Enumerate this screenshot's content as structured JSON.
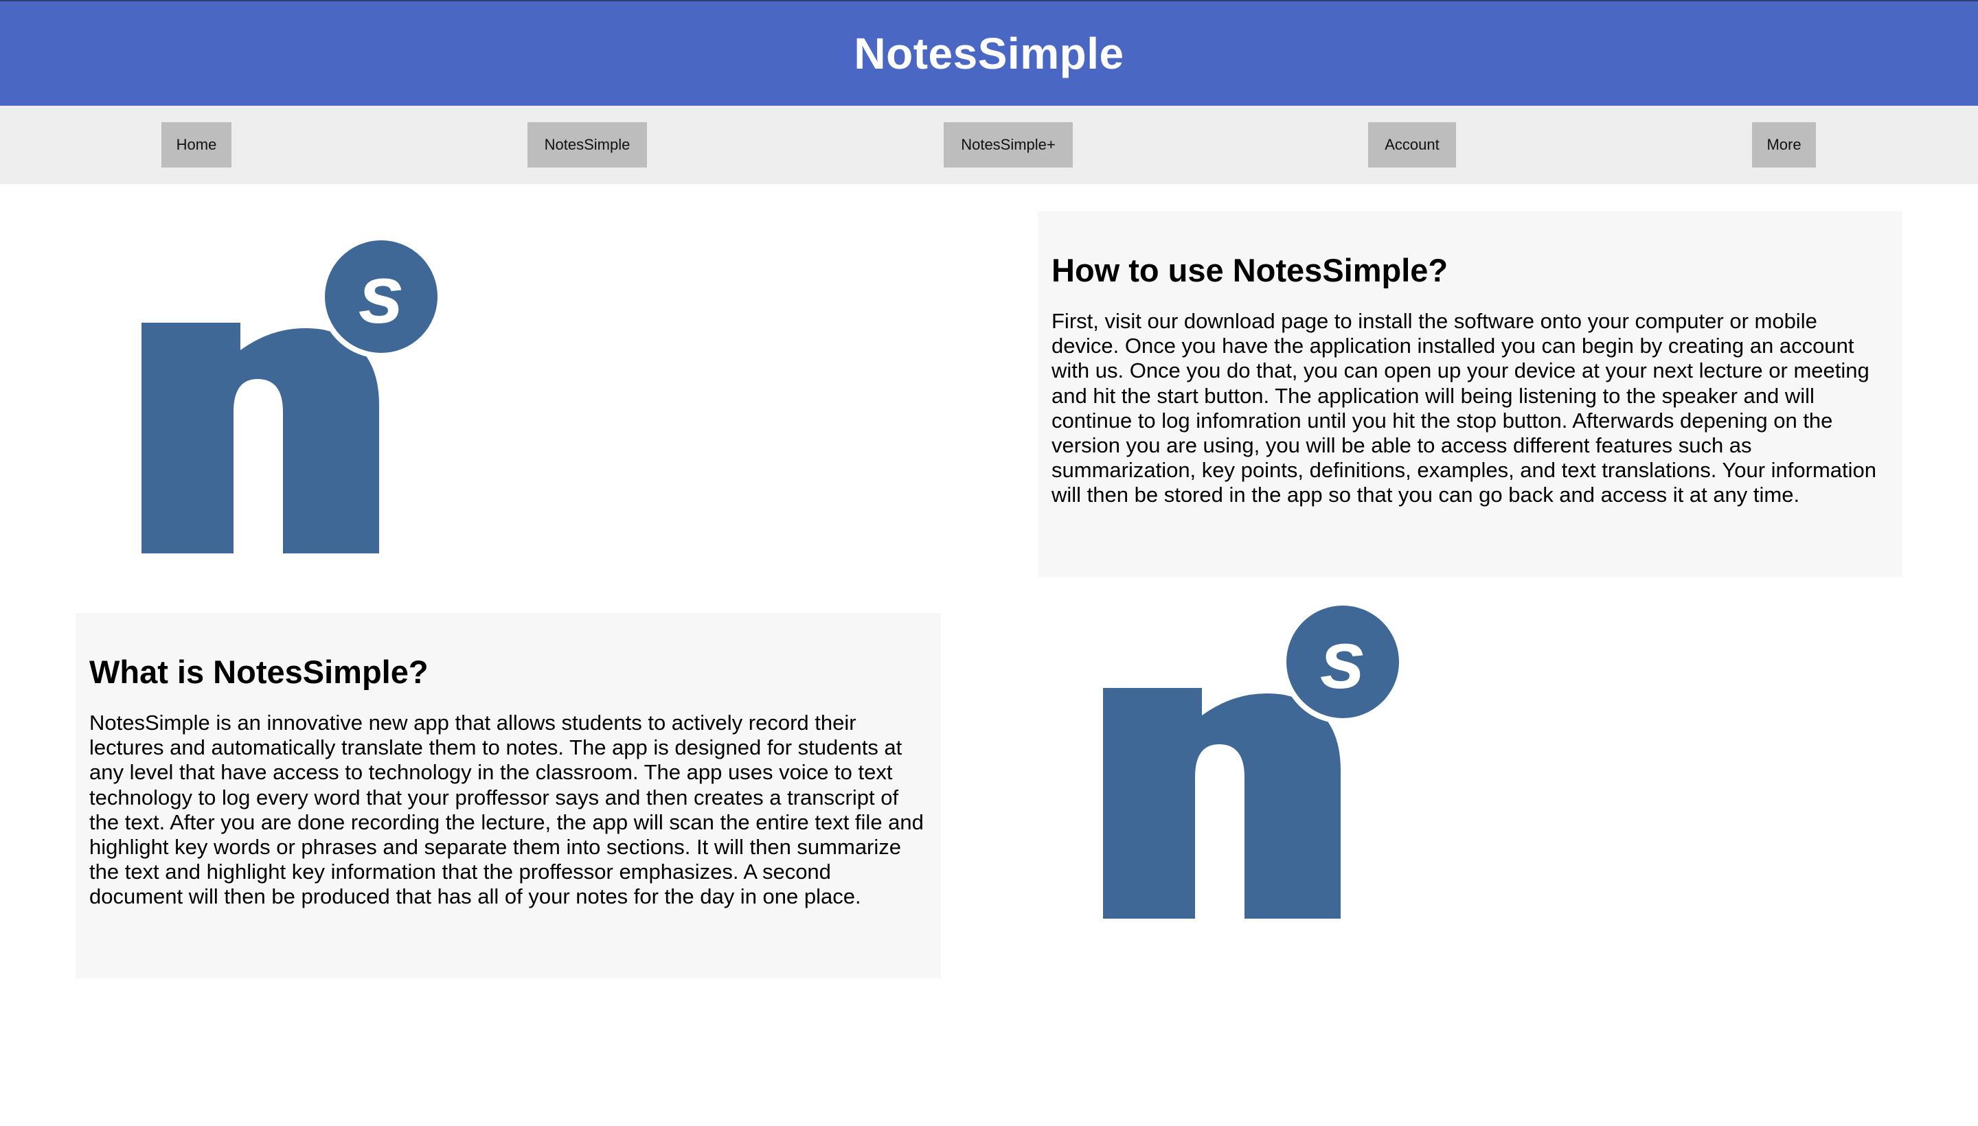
{
  "header": {
    "title": "NotesSimple",
    "background_color": "#4a67c4"
  },
  "nav": {
    "items": [
      {
        "label": "Home"
      },
      {
        "label": "NotesSimple"
      },
      {
        "label": "NotesSimple+"
      },
      {
        "label": "Account"
      },
      {
        "label": "More"
      }
    ]
  },
  "how_to": {
    "heading": "How to use NotesSimple?",
    "body": "First, visit our download page to install the software onto your computer or mobile device. Once you have the application installed you can begin by creating an account with us. Once you do that, you can open up your device at your next lecture or meeting and hit the start button. The application will being listening to the speaker and will continue to log infomration until you hit the stop button. Afterwards depening on the version you are using, you will be able to access different features such as summarization, key points, definitions, examples, and text translations. Your information will then be stored in the app so that you can go back and access it at any time."
  },
  "what_is": {
    "heading": "What is NotesSimple?",
    "body": "NotesSimple is an innovative new app that allows students to actively record their lectures and automatically translate them to notes. The app is designed for students at any level that have access to technology in the classroom. The app uses voice to text technology to log every word that your proffessor says and then creates a transcript of the text. After you are done recording the lecture, the app will scan the entire text file and highlight key words or phrases and separate them into sections. It will then summarize the text and highlight key information that the proffessor emphasizes. A second document will then be produced that has all of your notes for the day in one place."
  },
  "logo": {
    "icon": "notessimple-logo",
    "color": "#3f6897"
  }
}
